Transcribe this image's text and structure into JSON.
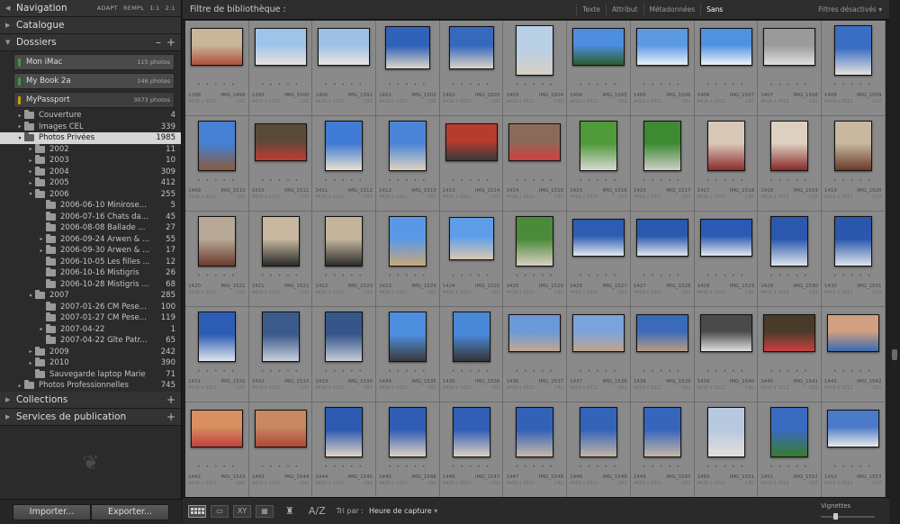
{
  "left": {
    "navigator": {
      "title": "Navigation",
      "zoom": [
        "ADAPT",
        "REMPL",
        "1:1",
        "2:1"
      ]
    },
    "catalog": {
      "title": "Catalogue"
    },
    "folders": {
      "title": "Dossiers",
      "minus": "–",
      "plus": "+"
    },
    "volumes": [
      {
        "name": "Mon iMac",
        "count": "115 photos"
      },
      {
        "name": "My Book 2a",
        "count": "146 photos"
      },
      {
        "name": "MyPassport",
        "count": "3073 photos"
      }
    ],
    "tree": [
      {
        "label": "Couverture",
        "count": "4",
        "arrow": "▸",
        "level": 1
      },
      {
        "label": "Images CEL",
        "count": "339",
        "arrow": "▸",
        "level": 1
      },
      {
        "label": "Photos Privées",
        "count": "1985",
        "arrow": "▾",
        "level": 1
      },
      {
        "label": "2002",
        "count": "11",
        "arrow": "▸",
        "level": 2
      },
      {
        "label": "2003",
        "count": "10",
        "arrow": "▸",
        "level": 2
      },
      {
        "label": "2004",
        "count": "309",
        "arrow": "▸",
        "level": 2
      },
      {
        "label": "2005",
        "count": "412",
        "arrow": "▸",
        "level": 2
      },
      {
        "label": "2006",
        "count": "255",
        "arrow": "▾",
        "level": 2
      },
      {
        "label": "2006-06-10 Minirose...",
        "count": "5",
        "arrow": "",
        "level": 3
      },
      {
        "label": "2006-07-16 Chats da...",
        "count": "45",
        "arrow": "",
        "level": 3
      },
      {
        "label": "2006-08-08 Ballade ...",
        "count": "27",
        "arrow": "",
        "level": 3
      },
      {
        "label": "2006-09-24 Arwen & ...",
        "count": "55",
        "arrow": "▸",
        "level": 3
      },
      {
        "label": "2006-09-30 Arwen & ...",
        "count": "17",
        "arrow": "▸",
        "level": 3
      },
      {
        "label": "2006-10-05 Les filles ...",
        "count": "12",
        "arrow": "",
        "level": 3
      },
      {
        "label": "2006-10-16 Mistigris",
        "count": "26",
        "arrow": "",
        "level": 3
      },
      {
        "label": "2006-10-28 Mistigris ...",
        "count": "68",
        "arrow": "",
        "level": 3
      },
      {
        "label": "2007",
        "count": "285",
        "arrow": "▾",
        "level": 2
      },
      {
        "label": "2007-01-26 CM Pese...",
        "count": "100",
        "arrow": "",
        "level": 3
      },
      {
        "label": "2007-01-27 CM Pese...",
        "count": "119",
        "arrow": "",
        "level": 3
      },
      {
        "label": "2007-04-22",
        "count": "1",
        "arrow": "▸",
        "level": 3
      },
      {
        "label": "2007-04-22 Gîte Patr...",
        "count": "65",
        "arrow": "",
        "level": 3
      },
      {
        "label": "2009",
        "count": "242",
        "arrow": "▸",
        "level": 2
      },
      {
        "label": "2010",
        "count": "390",
        "arrow": "▸",
        "level": 2
      },
      {
        "label": "Sauvegarde laptop Marie",
        "count": "71",
        "arrow": "",
        "level": 2
      },
      {
        "label": "Photos Professionnelles",
        "count": "745",
        "arrow": "▸",
        "level": 1
      }
    ],
    "collections": {
      "title": "Collections",
      "plus": "+"
    },
    "publish": {
      "title": "Services de publication",
      "plus": "+"
    },
    "plate_glyph": "❦",
    "import_label": "Importer...",
    "export_label": "Exporter..."
  },
  "filter": {
    "title": "Filtre de bibliothèque :",
    "options": [
      "Texte",
      "Attribut",
      "Métadonnées",
      "Sans"
    ],
    "active": "Sans",
    "status": "Filtres désactivés"
  },
  "grid": {
    "dims": "4416 x 3312",
    "ext": "CR2",
    "rating_dots": "• • • • •",
    "rows": [
      [
        {
          "num": "1398",
          "name": "IMG_1499",
          "o": "l",
          "c": [
            "#c9b59a",
            "#b04f3a"
          ]
        },
        {
          "num": "1399",
          "name": "IMG_1500",
          "o": "l",
          "c": [
            "#9fc4ea",
            "#e7e2dc"
          ]
        },
        {
          "num": "1400",
          "name": "IMG_1501",
          "o": "l",
          "c": [
            "#9dc0e6",
            "#ebe6de"
          ]
        },
        {
          "num": "1401",
          "name": "IMG_1502",
          "o": "s",
          "c": [
            "#2f62b8",
            "#ded6c8"
          ]
        },
        {
          "num": "1402",
          "name": "IMG_1503",
          "o": "s",
          "c": [
            "#3668be",
            "#ddd4c4"
          ]
        },
        {
          "num": "1403",
          "name": "IMG_1504",
          "o": "p",
          "c": [
            "#b8cfe4",
            "#d6d0c6"
          ]
        },
        {
          "num": "1404",
          "name": "IMG_1505",
          "o": "l",
          "c": [
            "#4d8ee0",
            "#2c5d2c"
          ]
        },
        {
          "num": "1405",
          "name": "IMG_1506",
          "o": "l",
          "c": [
            "#5b99e2",
            "#e8f0f8"
          ]
        },
        {
          "num": "1406",
          "name": "IMG_1507",
          "o": "l",
          "c": [
            "#4f92e0",
            "#eef3f8"
          ]
        },
        {
          "num": "1407",
          "name": "IMG_1508",
          "o": "l",
          "c": [
            "#9a9a9a",
            "#e0e0e0"
          ]
        },
        {
          "num": "1408",
          "name": "IMG_1509",
          "o": "p",
          "c": [
            "#3a6dc4",
            "#e6e3df"
          ]
        }
      ],
      [
        {
          "num": "1409",
          "name": "IMG_1510",
          "o": "p",
          "c": [
            "#4580d4",
            "#8a5a3c"
          ]
        },
        {
          "num": "1410",
          "name": "IMG_1511",
          "o": "l",
          "c": [
            "#5a4a3a",
            "#c23b30"
          ]
        },
        {
          "num": "1411",
          "name": "IMG_1512",
          "o": "p",
          "c": [
            "#3f7ad4",
            "#e8e0d0"
          ]
        },
        {
          "num": "1412",
          "name": "IMG_1513",
          "o": "p",
          "c": [
            "#4a85d8",
            "#ddd3c0"
          ]
        },
        {
          "num": "1413",
          "name": "IMG_1514",
          "o": "l",
          "c": [
            "#b83c2c",
            "#3a3a3a"
          ]
        },
        {
          "num": "1414",
          "name": "IMG_1515",
          "o": "l",
          "c": [
            "#8c6a5a",
            "#d04040"
          ]
        },
        {
          "num": "1415",
          "name": "IMG_1516",
          "o": "p",
          "c": [
            "#4f9a3a",
            "#d8d8d0"
          ]
        },
        {
          "num": "1416",
          "name": "IMG_1517",
          "o": "p",
          "c": [
            "#3e8a32",
            "#cfcfc8"
          ]
        },
        {
          "num": "1417",
          "name": "IMG_1518",
          "o": "p",
          "c": [
            "#d8c8b8",
            "#8c2c2c"
          ]
        },
        {
          "num": "1418",
          "name": "IMG_1519",
          "o": "p",
          "c": [
            "#ddd0c0",
            "#8a2a2a"
          ]
        },
        {
          "num": "1419",
          "name": "IMG_1520",
          "o": "p",
          "c": [
            "#c8b8a0",
            "#6a3a2a"
          ]
        }
      ],
      [
        {
          "num": "1420",
          "name": "IMG_1521",
          "o": "p",
          "c": [
            "#b8a898",
            "#6a3a2a"
          ]
        },
        {
          "num": "1421",
          "name": "IMG_1522",
          "o": "p",
          "c": [
            "#c8b8a0",
            "#2a2a2a"
          ]
        },
        {
          "num": "1422",
          "name": "IMG_1523",
          "o": "p",
          "c": [
            "#c4b49c",
            "#2c2c2c"
          ]
        },
        {
          "num": "1423",
          "name": "IMG_1524",
          "o": "p",
          "c": [
            "#5a98e6",
            "#c8a878"
          ]
        },
        {
          "num": "1424",
          "name": "IMG_1525",
          "o": "s",
          "c": [
            "#5e9ee8",
            "#d8c8b0"
          ]
        },
        {
          "num": "1425",
          "name": "IMG_1526",
          "o": "p",
          "c": [
            "#4a8a3a",
            "#d8d0c0"
          ]
        },
        {
          "num": "1426",
          "name": "IMG_1527",
          "o": "l",
          "c": [
            "#2e5cb0",
            "#e0e8f0"
          ]
        },
        {
          "num": "1427",
          "name": "IMG_1528",
          "o": "l",
          "c": [
            "#2a58ae",
            "#dfe6ee"
          ]
        },
        {
          "num": "1428",
          "name": "IMG_1529",
          "o": "l",
          "c": [
            "#2c5ab2",
            "#e2e8ef"
          ]
        },
        {
          "num": "1429",
          "name": "IMG_1530",
          "o": "p",
          "c": [
            "#2b57ad",
            "#dce4ec"
          ]
        },
        {
          "num": "1430",
          "name": "IMG_1531",
          "o": "p",
          "c": [
            "#2a56ab",
            "#dde5ed"
          ]
        }
      ],
      [
        {
          "num": "1431",
          "name": "IMG_1532",
          "o": "p",
          "c": [
            "#2d5cb4",
            "#dde4ec"
          ]
        },
        {
          "num": "1432",
          "name": "IMG_1533",
          "o": "p",
          "c": [
            "#3a5a8a",
            "#c8d0dc"
          ]
        },
        {
          "num": "1433",
          "name": "IMG_1534",
          "o": "p",
          "c": [
            "#36568a",
            "#c4ccd8"
          ]
        },
        {
          "num": "1434",
          "name": "IMG_1535",
          "o": "p",
          "c": [
            "#4d8ede",
            "#3a3a3a"
          ]
        },
        {
          "num": "1435",
          "name": "IMG_1536",
          "o": "p",
          "c": [
            "#4a88d8",
            "#343434"
          ]
        },
        {
          "num": "1436",
          "name": "IMG_1537",
          "o": "l",
          "c": [
            "#6a98d8",
            "#c0a890"
          ]
        },
        {
          "num": "1437",
          "name": "IMG_1538",
          "o": "l",
          "c": [
            "#7aa4dc",
            "#bfa48c"
          ]
        },
        {
          "num": "1438",
          "name": "IMG_1539",
          "o": "l",
          "c": [
            "#3a6ab8",
            "#b89c84"
          ]
        },
        {
          "num": "1439",
          "name": "IMG_1540",
          "o": "l",
          "c": [
            "#4a4a4a",
            "#e0e0e0"
          ]
        },
        {
          "num": "1440",
          "name": "IMG_1541",
          "o": "l",
          "c": [
            "#4a3a2a",
            "#c84040"
          ]
        },
        {
          "num": "1441",
          "name": "IMG_1542",
          "o": "l",
          "c": [
            "#d0a080",
            "#3a6ab0"
          ]
        }
      ],
      [
        {
          "num": "1442",
          "name": "IMG_1543",
          "o": "l",
          "c": [
            "#d89060",
            "#c04040"
          ]
        },
        {
          "num": "1443",
          "name": "IMG_1544",
          "o": "l",
          "c": [
            "#c88860",
            "#b04838"
          ]
        },
        {
          "num": "1444",
          "name": "IMG_1545",
          "o": "p",
          "c": [
            "#2c5ab0",
            "#e0d4c4"
          ]
        },
        {
          "num": "1445",
          "name": "IMG_1546",
          "o": "p",
          "c": [
            "#2e5cb4",
            "#ded2c2"
          ]
        },
        {
          "num": "1446",
          "name": "IMG_1547",
          "o": "p",
          "c": [
            "#305eb6",
            "#dcd0c0"
          ]
        },
        {
          "num": "1447",
          "name": "IMG_1548",
          "o": "p",
          "c": [
            "#3262b8",
            "#c8b8a8"
          ]
        },
        {
          "num": "1448",
          "name": "IMG_1549",
          "o": "p",
          "c": [
            "#3464ba",
            "#c4b4a4"
          ]
        },
        {
          "num": "1449",
          "name": "IMG_1550",
          "o": "p",
          "c": [
            "#3666bc",
            "#c6b6a6"
          ]
        },
        {
          "num": "1450",
          "name": "IMG_1551",
          "o": "p",
          "c": [
            "#b8c8e0",
            "#e4e0d8"
          ]
        },
        {
          "num": "1451",
          "name": "IMG_1552",
          "o": "p",
          "c": [
            "#3a6ac0",
            "#3a7a30"
          ]
        },
        {
          "num": "1452",
          "name": "IMG_1553",
          "o": "l",
          "c": [
            "#4a7ac8",
            "#e8e8e8"
          ]
        }
      ]
    ]
  },
  "toolbar": {
    "sort_label": "Tri par :",
    "sort_value": "Heure de capture",
    "thumb_label": "Vignettes",
    "thumb_level": 0.25,
    "compare_label": "XY",
    "sort_icon_label": "A/Z"
  }
}
